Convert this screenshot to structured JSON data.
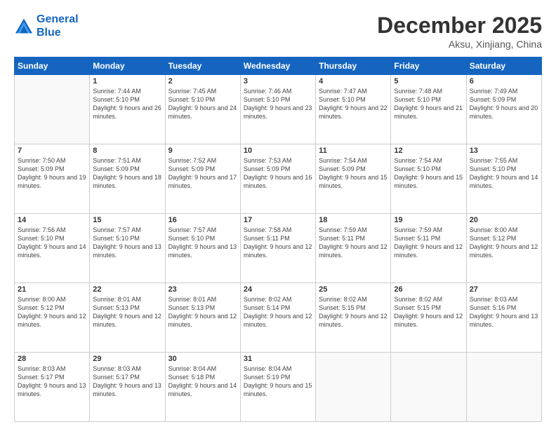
{
  "logo": {
    "line1": "General",
    "line2": "Blue"
  },
  "title": "December 2025",
  "location": "Aksu, Xinjiang, China",
  "weekdays": [
    "Sunday",
    "Monday",
    "Tuesday",
    "Wednesday",
    "Thursday",
    "Friday",
    "Saturday"
  ],
  "weeks": [
    [
      {
        "day": "",
        "sunrise": "",
        "sunset": "",
        "daylight": ""
      },
      {
        "day": "1",
        "sunrise": "Sunrise: 7:44 AM",
        "sunset": "Sunset: 5:10 PM",
        "daylight": "Daylight: 9 hours and 26 minutes."
      },
      {
        "day": "2",
        "sunrise": "Sunrise: 7:45 AM",
        "sunset": "Sunset: 5:10 PM",
        "daylight": "Daylight: 9 hours and 24 minutes."
      },
      {
        "day": "3",
        "sunrise": "Sunrise: 7:46 AM",
        "sunset": "Sunset: 5:10 PM",
        "daylight": "Daylight: 9 hours and 23 minutes."
      },
      {
        "day": "4",
        "sunrise": "Sunrise: 7:47 AM",
        "sunset": "Sunset: 5:10 PM",
        "daylight": "Daylight: 9 hours and 22 minutes."
      },
      {
        "day": "5",
        "sunrise": "Sunrise: 7:48 AM",
        "sunset": "Sunset: 5:10 PM",
        "daylight": "Daylight: 9 hours and 21 minutes."
      },
      {
        "day": "6",
        "sunrise": "Sunrise: 7:49 AM",
        "sunset": "Sunset: 5:09 PM",
        "daylight": "Daylight: 9 hours and 20 minutes."
      }
    ],
    [
      {
        "day": "7",
        "sunrise": "Sunrise: 7:50 AM",
        "sunset": "Sunset: 5:09 PM",
        "daylight": "Daylight: 9 hours and 19 minutes."
      },
      {
        "day": "8",
        "sunrise": "Sunrise: 7:51 AM",
        "sunset": "Sunset: 5:09 PM",
        "daylight": "Daylight: 9 hours and 18 minutes."
      },
      {
        "day": "9",
        "sunrise": "Sunrise: 7:52 AM",
        "sunset": "Sunset: 5:09 PM",
        "daylight": "Daylight: 9 hours and 17 minutes."
      },
      {
        "day": "10",
        "sunrise": "Sunrise: 7:53 AM",
        "sunset": "Sunset: 5:09 PM",
        "daylight": "Daylight: 9 hours and 16 minutes."
      },
      {
        "day": "11",
        "sunrise": "Sunrise: 7:54 AM",
        "sunset": "Sunset: 5:09 PM",
        "daylight": "Daylight: 9 hours and 15 minutes."
      },
      {
        "day": "12",
        "sunrise": "Sunrise: 7:54 AM",
        "sunset": "Sunset: 5:10 PM",
        "daylight": "Daylight: 9 hours and 15 minutes."
      },
      {
        "day": "13",
        "sunrise": "Sunrise: 7:55 AM",
        "sunset": "Sunset: 5:10 PM",
        "daylight": "Daylight: 9 hours and 14 minutes."
      }
    ],
    [
      {
        "day": "14",
        "sunrise": "Sunrise: 7:56 AM",
        "sunset": "Sunset: 5:10 PM",
        "daylight": "Daylight: 9 hours and 14 minutes."
      },
      {
        "day": "15",
        "sunrise": "Sunrise: 7:57 AM",
        "sunset": "Sunset: 5:10 PM",
        "daylight": "Daylight: 9 hours and 13 minutes."
      },
      {
        "day": "16",
        "sunrise": "Sunrise: 7:57 AM",
        "sunset": "Sunset: 5:10 PM",
        "daylight": "Daylight: 9 hours and 13 minutes."
      },
      {
        "day": "17",
        "sunrise": "Sunrise: 7:58 AM",
        "sunset": "Sunset: 5:11 PM",
        "daylight": "Daylight: 9 hours and 12 minutes."
      },
      {
        "day": "18",
        "sunrise": "Sunrise: 7:59 AM",
        "sunset": "Sunset: 5:11 PM",
        "daylight": "Daylight: 9 hours and 12 minutes."
      },
      {
        "day": "19",
        "sunrise": "Sunrise: 7:59 AM",
        "sunset": "Sunset: 5:11 PM",
        "daylight": "Daylight: 9 hours and 12 minutes."
      },
      {
        "day": "20",
        "sunrise": "Sunrise: 8:00 AM",
        "sunset": "Sunset: 5:12 PM",
        "daylight": "Daylight: 9 hours and 12 minutes."
      }
    ],
    [
      {
        "day": "21",
        "sunrise": "Sunrise: 8:00 AM",
        "sunset": "Sunset: 5:12 PM",
        "daylight": "Daylight: 9 hours and 12 minutes."
      },
      {
        "day": "22",
        "sunrise": "Sunrise: 8:01 AM",
        "sunset": "Sunset: 5:13 PM",
        "daylight": "Daylight: 9 hours and 12 minutes."
      },
      {
        "day": "23",
        "sunrise": "Sunrise: 8:01 AM",
        "sunset": "Sunset: 5:13 PM",
        "daylight": "Daylight: 9 hours and 12 minutes."
      },
      {
        "day": "24",
        "sunrise": "Sunrise: 8:02 AM",
        "sunset": "Sunset: 5:14 PM",
        "daylight": "Daylight: 9 hours and 12 minutes."
      },
      {
        "day": "25",
        "sunrise": "Sunrise: 8:02 AM",
        "sunset": "Sunset: 5:15 PM",
        "daylight": "Daylight: 9 hours and 12 minutes."
      },
      {
        "day": "26",
        "sunrise": "Sunrise: 8:02 AM",
        "sunset": "Sunset: 5:15 PM",
        "daylight": "Daylight: 9 hours and 12 minutes."
      },
      {
        "day": "27",
        "sunrise": "Sunrise: 8:03 AM",
        "sunset": "Sunset: 5:16 PM",
        "daylight": "Daylight: 9 hours and 13 minutes."
      }
    ],
    [
      {
        "day": "28",
        "sunrise": "Sunrise: 8:03 AM",
        "sunset": "Sunset: 5:17 PM",
        "daylight": "Daylight: 9 hours and 13 minutes."
      },
      {
        "day": "29",
        "sunrise": "Sunrise: 8:03 AM",
        "sunset": "Sunset: 5:17 PM",
        "daylight": "Daylight: 9 hours and 13 minutes."
      },
      {
        "day": "30",
        "sunrise": "Sunrise: 8:04 AM",
        "sunset": "Sunset: 5:18 PM",
        "daylight": "Daylight: 9 hours and 14 minutes."
      },
      {
        "day": "31",
        "sunrise": "Sunrise: 8:04 AM",
        "sunset": "Sunset: 5:19 PM",
        "daylight": "Daylight: 9 hours and 15 minutes."
      },
      {
        "day": "",
        "sunrise": "",
        "sunset": "",
        "daylight": ""
      },
      {
        "day": "",
        "sunrise": "",
        "sunset": "",
        "daylight": ""
      },
      {
        "day": "",
        "sunrise": "",
        "sunset": "",
        "daylight": ""
      }
    ]
  ]
}
